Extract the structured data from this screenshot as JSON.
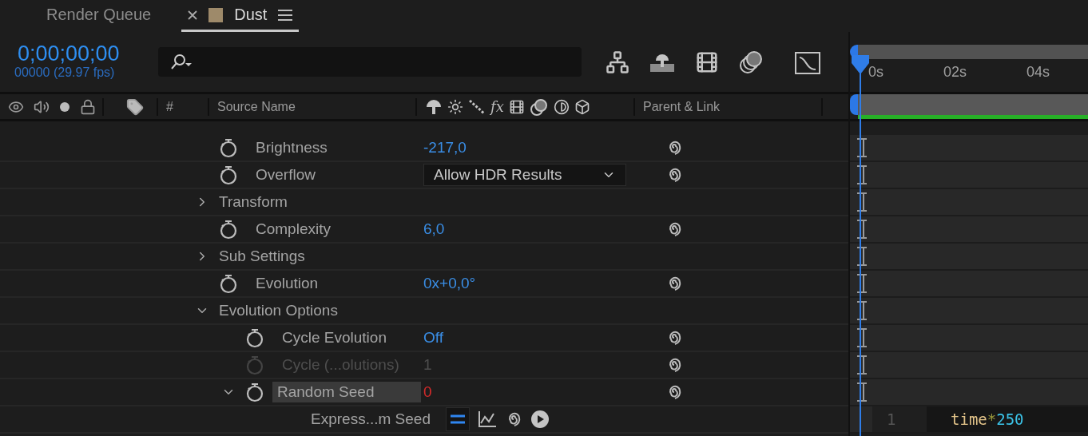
{
  "tabs": [
    {
      "label": "Render Queue",
      "selected": false,
      "closable": false
    },
    {
      "label": "Dust",
      "selected": true,
      "closable": true,
      "color": "#9e8a6a"
    }
  ],
  "timecode": "0;00;00;00",
  "frame_info": "00000 (29.97 fps)",
  "column_headers": {
    "number": "#",
    "source_name": "Source Name",
    "effects_switch": "fx",
    "parent_link": "Parent & Link"
  },
  "rows": [
    {
      "kind": "number",
      "label": "Brightness",
      "value": "-217,0",
      "disabled": false,
      "selected": false
    },
    {
      "kind": "dropdown",
      "label": "Overflow",
      "value": "Allow HDR Results",
      "disabled": false,
      "selected": false
    },
    {
      "kind": "group",
      "label": "Transform",
      "expanded": false,
      "disabled": false,
      "selected": false
    },
    {
      "kind": "number",
      "label": "Complexity",
      "value": "6,0",
      "disabled": false,
      "selected": false
    },
    {
      "kind": "group",
      "label": "Sub Settings",
      "expanded": false,
      "disabled": false,
      "selected": false
    },
    {
      "kind": "number",
      "label": "Evolution",
      "value": "0x+0,0°",
      "disabled": false,
      "selected": false
    },
    {
      "kind": "group",
      "label": "Evolution Options",
      "expanded": true,
      "disabled": false,
      "selected": false,
      "children": [
        {
          "kind": "number",
          "label": "Cycle Evolution",
          "value": "Off",
          "disabled": false,
          "selected": false
        },
        {
          "kind": "number",
          "label": "Cycle (...olutions)",
          "value": "1",
          "disabled": true,
          "selected": false
        },
        {
          "kind": "driven",
          "label": "Random Seed",
          "value": "0",
          "expanded": true,
          "disabled": false,
          "selected": true,
          "children": [
            {
              "kind": "expression",
              "label": "Express...m Seed",
              "disabled": false,
              "selected": false,
              "enabled": true,
              "line_number": "1",
              "tokens": [
                {
                  "text": "time",
                  "kind": "identifier"
                },
                {
                  "text": "*",
                  "kind": "operator"
                },
                {
                  "text": "250",
                  "kind": "number"
                }
              ]
            }
          ]
        }
      ]
    }
  ],
  "ruler_labels": [
    "0s",
    "02s",
    "04s"
  ],
  "render_bar": {
    "level": 1
  }
}
